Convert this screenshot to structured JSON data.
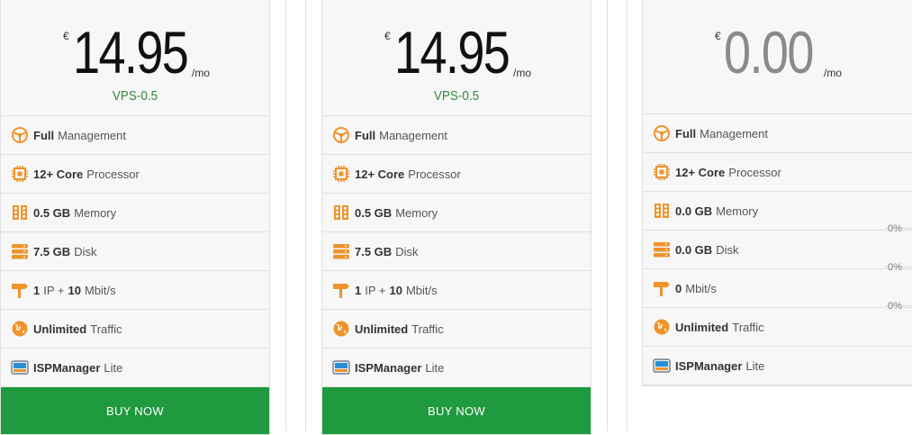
{
  "cards": [
    {
      "currency": "€",
      "amount": "14.95",
      "per": "/mo",
      "plan": "VPS-0.5",
      "features": [
        {
          "icon": "steering-wheel-icon",
          "bold": "Full",
          "text": "Management"
        },
        {
          "icon": "cpu-chip-icon",
          "bold": "12+ Core",
          "text": "Processor"
        },
        {
          "icon": "memory-icon",
          "bold": "0.5 GB",
          "text": "Memory"
        },
        {
          "icon": "disk-server-icon",
          "bold": "7.5 GB",
          "text": "Disk"
        },
        {
          "icon": "signpost-icon",
          "bold": "1",
          "mid": "IP +",
          "bold2": "10",
          "text": "Mbit/s"
        },
        {
          "icon": "globe-icon",
          "bold": "Unlimited",
          "text": "Traffic"
        },
        {
          "icon": "ispmanager-icon",
          "bold": "ISPManager",
          "text": "Lite"
        }
      ],
      "button": "BUY NOW"
    },
    {
      "currency": "€",
      "amount": "14.95",
      "per": "/mo",
      "plan": "VPS-0.5",
      "features": [
        {
          "icon": "steering-wheel-icon",
          "bold": "Full",
          "text": "Management"
        },
        {
          "icon": "cpu-chip-icon",
          "bold": "12+ Core",
          "text": "Processor"
        },
        {
          "icon": "memory-icon",
          "bold": "0.5 GB",
          "text": "Memory"
        },
        {
          "icon": "disk-server-icon",
          "bold": "7.5 GB",
          "text": "Disk"
        },
        {
          "icon": "signpost-icon",
          "bold": "1",
          "mid": "IP +",
          "bold2": "10",
          "text": "Mbit/s"
        },
        {
          "icon": "globe-icon",
          "bold": "Unlimited",
          "text": "Traffic"
        },
        {
          "icon": "ispmanager-icon",
          "bold": "ISPManager",
          "text": "Lite"
        }
      ],
      "button": "BUY NOW"
    },
    {
      "currency": "€",
      "amount": "0.00",
      "per": "/mo",
      "features": [
        {
          "icon": "steering-wheel-icon",
          "bold": "Full",
          "text": "Management"
        },
        {
          "icon": "cpu-chip-icon",
          "bold": "12+ Core",
          "text": "Processor"
        },
        {
          "icon": "memory-icon",
          "bold": "0.0 GB",
          "text": "Memory"
        },
        {
          "icon": "disk-server-icon",
          "bold": "0.0 GB",
          "text": "Disk"
        },
        {
          "icon": "signpost-icon",
          "bold": "0",
          "text": "Mbit/s"
        },
        {
          "icon": "globe-icon",
          "bold": "Unlimited",
          "text": "Traffic"
        },
        {
          "icon": "ispmanager-icon",
          "bold": "ISPManager",
          "text": "Lite"
        }
      ]
    }
  ],
  "percent_labels": [
    "0%",
    "0%",
    "0%"
  ],
  "colors": {
    "accent_orange": "#f0932b",
    "plan_green": "#2f8a3a",
    "buy_green": "#1f9a3e"
  }
}
